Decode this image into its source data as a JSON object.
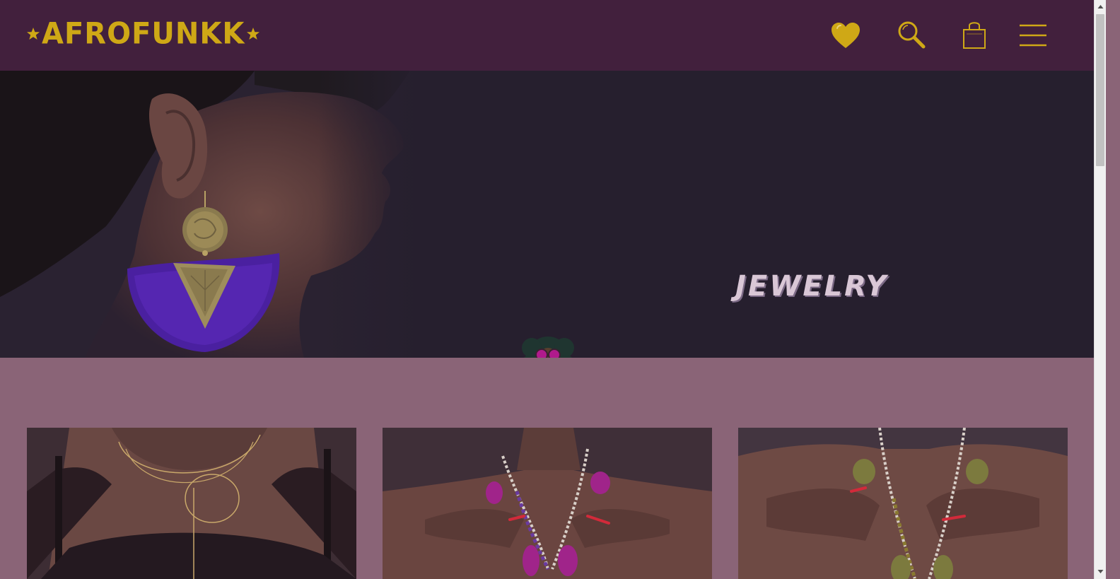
{
  "brand": {
    "name": "AFROFUNKK",
    "accent": "#cfa816",
    "header_bg": "#42203d",
    "page_bg": "#8a6477"
  },
  "header": {
    "icons": [
      "heart-icon",
      "search-icon",
      "shopping-bag-icon",
      "menu-icon"
    ]
  },
  "hero": {
    "title": "JEWELRY",
    "background": "#261f2e",
    "image": "model-with-fringe-earring",
    "badge": "afro-girl-sunglasses-logo"
  },
  "products": [
    {
      "image": "gold-chain-necklace"
    },
    {
      "image": "purple-tassel-bead-necklace"
    },
    {
      "image": "olive-tassel-bead-necklace"
    }
  ]
}
